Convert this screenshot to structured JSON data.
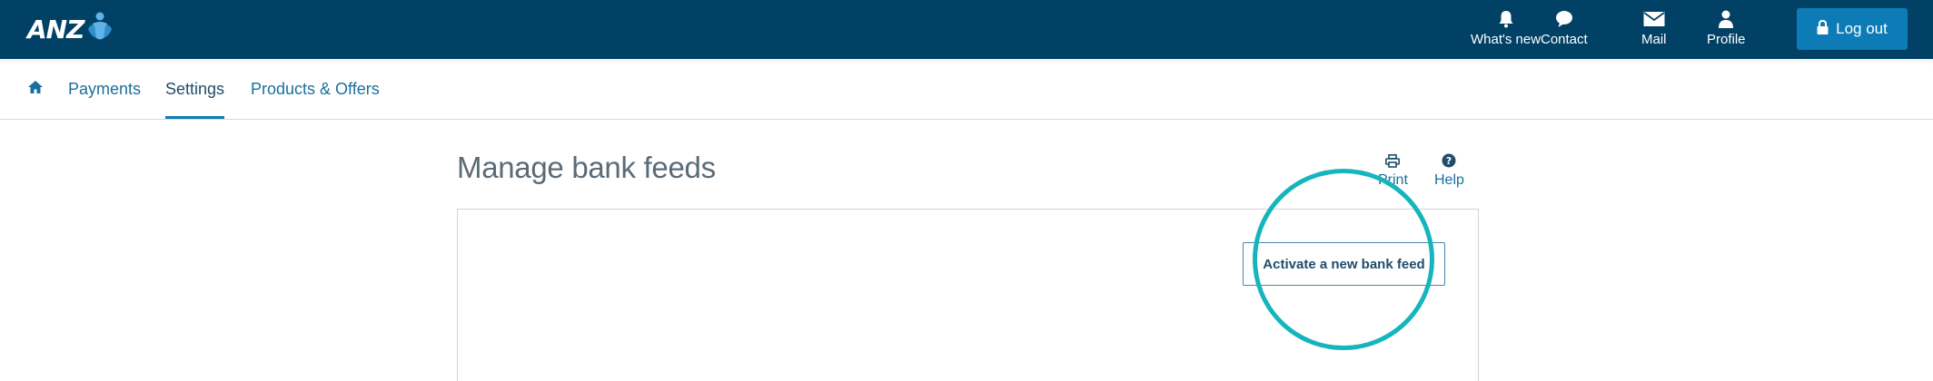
{
  "header": {
    "logo_text": "ANZ",
    "utility": [
      {
        "label": "What's new",
        "icon": "bell-icon"
      },
      {
        "label": "Contact",
        "icon": "speech-bubble-icon"
      },
      {
        "label": "Mail",
        "icon": "envelope-icon"
      },
      {
        "label": "Profile",
        "icon": "person-icon"
      }
    ],
    "logout_label": "Log out"
  },
  "nav": {
    "items": [
      {
        "label": "Payments"
      },
      {
        "label": "Settings",
        "active": true
      },
      {
        "label": "Products & Offers"
      }
    ]
  },
  "main": {
    "title": "Manage bank feeds",
    "tools": [
      {
        "label": "Print",
        "icon": "printer-icon"
      },
      {
        "label": "Help",
        "icon": "question-circle-icon"
      }
    ],
    "activate_button_label": "Activate a new bank feed"
  },
  "colors": {
    "header_bg": "#004165",
    "accent": "#0d7bb5",
    "link": "#1a6f9e",
    "highlight": "#16b5bd"
  }
}
